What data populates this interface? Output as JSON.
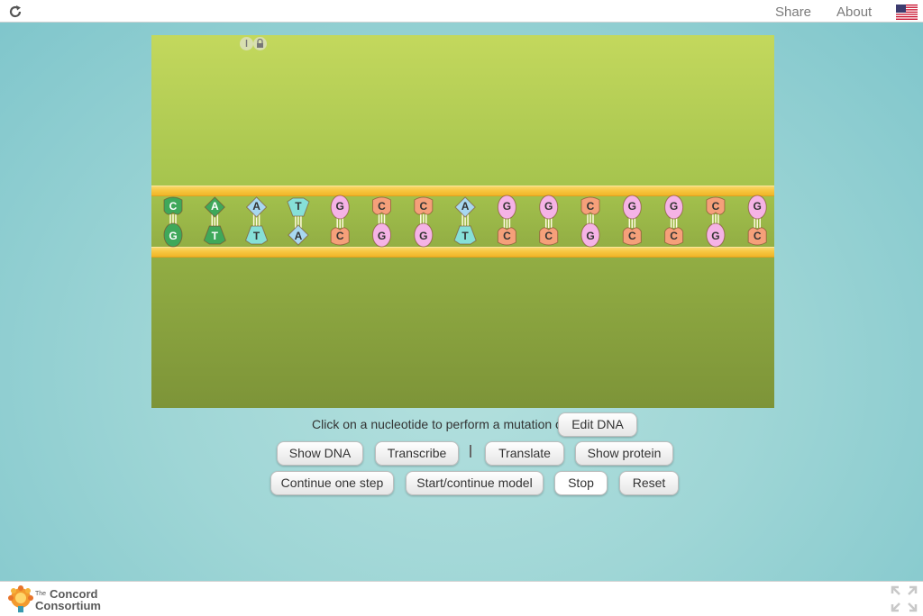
{
  "topbar": {
    "share": "Share",
    "about": "About",
    "reload_icon": "reload-icon",
    "flag_icon": "us-flag-icon"
  },
  "dna": {
    "top_strand": [
      "C",
      "A",
      "A",
      "T",
      "G",
      "C",
      "C",
      "A",
      "G",
      "G",
      "C",
      "G",
      "G",
      "C",
      "G"
    ],
    "bottom_strand": [
      "G",
      "T",
      "T",
      "A",
      "C",
      "G",
      "G",
      "T",
      "C",
      "C",
      "G",
      "C",
      "C",
      "G",
      "C"
    ],
    "colors": {
      "A": "#a8d8f0",
      "T": "#86e0d8",
      "G": "#f5b3e6",
      "C": "#f5a07a",
      "CG_pair": "#3fa85a",
      "AT_pair": "#3fa85a",
      "strand": "#f7c640"
    }
  },
  "controls": {
    "mutation_label": "Click on a nucleotide to perform a mutation or",
    "edit_dna": "Edit DNA",
    "show_dna": "Show DNA",
    "transcribe": "Transcribe",
    "translate": "Translate",
    "show_protein": "Show protein",
    "continue_one_step": "Continue one step",
    "start_continue": "Start/continue model",
    "stop": "Stop",
    "reset": "Reset"
  },
  "footer": {
    "logo_small": "The",
    "logo_line1": "Concord",
    "logo_line2": "Consortium"
  }
}
